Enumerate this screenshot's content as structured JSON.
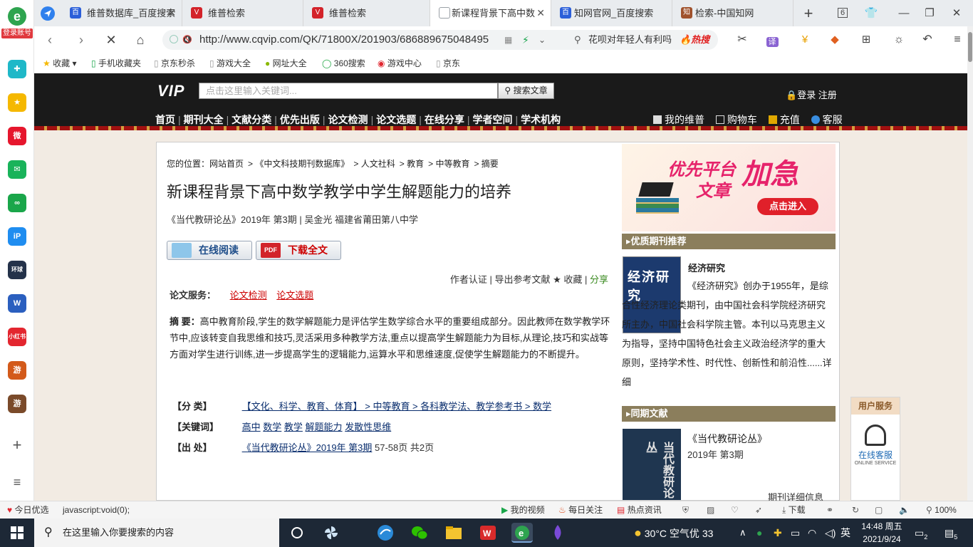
{
  "sidebar": {
    "account_label": "登录账号",
    "apps": [
      {
        "icon": "plus-app-icon",
        "color": "#1fb8c8",
        "text": "✚"
      },
      {
        "icon": "star-app-icon",
        "color": "#f5b800",
        "text": "★"
      },
      {
        "icon": "weibo-icon",
        "color": "#e6162d",
        "text": "微"
      },
      {
        "icon": "mail-app-icon",
        "color": "#19b35a",
        "text": "✉"
      },
      {
        "icon": "link-app-icon",
        "color": "#1aa64a",
        "text": "∞"
      },
      {
        "icon": "ip-app-icon",
        "color": "#1f8df0",
        "text": "iP"
      },
      {
        "icon": "globe-school-icon",
        "color": "#24324a",
        "text": "环球"
      },
      {
        "icon": "word-doc-icon",
        "color": "#2b5fbf",
        "text": "W"
      },
      {
        "icon": "xiaohongshu-icon",
        "color": "#e3262f",
        "text": "小红书"
      },
      {
        "icon": "game-app-icon",
        "color": "#d35a1a",
        "text": "游"
      },
      {
        "icon": "game2-app-icon",
        "color": "#7a4a2a",
        "text": "游"
      }
    ],
    "add_label": "+",
    "menu_label": "≡"
  },
  "tabs": [
    {
      "label": "维普数据库_百度搜索",
      "favicon": "baidu-paw-icon",
      "color": "#2b5fd9",
      "fav_text": "百"
    },
    {
      "label": "维普检索",
      "favicon": "vip-check-icon",
      "color": "#d3232a",
      "fav_text": "V"
    },
    {
      "label": "维普检索",
      "favicon": "vip-check-icon",
      "color": "#d3232a",
      "fav_text": "V"
    },
    {
      "label": "新课程背景下高中数",
      "favicon": "page-icon",
      "color": "#9aa0a6",
      "fav_text": "▯",
      "active": true
    },
    {
      "label": "知网官网_百度搜索",
      "favicon": "baidu-paw-icon",
      "color": "#2b5fd9",
      "fav_text": "百"
    },
    {
      "label": "检索-中国知网",
      "favicon": "cnki-icon",
      "color": "#a0522d",
      "fav_text": "知"
    }
  ],
  "tab_controls": {
    "new_tab": "+",
    "tab_count": "6"
  },
  "navbar": {
    "url": "http://www.cqvip.com/QK/71800X/201903/686889675048495",
    "search_text": "花呗对年轻人有利吗",
    "search_hot": "🔥热搜",
    "translate_label": "译"
  },
  "bookmarks": [
    "收藏",
    "手机收藏夹",
    "京东秒杀",
    "游戏大全",
    "网址大全",
    "360搜索",
    "游戏中心",
    "京东"
  ],
  "site": {
    "logo": "VIP",
    "search_placeholder": "点击这里输入关键词...",
    "search_button": "搜索文章",
    "login": "登录 注册",
    "nav": [
      "首页",
      "期刊大全",
      "文献分类",
      "优先出版",
      "论文检测",
      "论文选题",
      "在线分享",
      "学者空间",
      "学术机构"
    ],
    "right_nav": [
      "我的维普",
      "购物车",
      "充值",
      "客服"
    ]
  },
  "article": {
    "breadcrumb": [
      "您的位置：网站首页",
      "《中文科技期刊数据库》",
      "人文社科",
      "教育",
      "中等教育",
      "摘要"
    ],
    "title": "新课程背景下高中数学教学中学生解题能力的培养",
    "meta": "《当代教研论丛》2019年 第3期 | 吴金光   福建省莆田第八中学",
    "read_button": "在线阅读",
    "download_button": "下载全文",
    "tools": "作者认证 | 导出参考文献 ★ 收藏 |",
    "share": "分享",
    "service_label": "论文服务：",
    "service_links": [
      "论文检测",
      "论文选题"
    ],
    "abstract_label": "摘   要：",
    "abstract_text": "高中教育阶段,学生的数学解题能力是评估学生数学综合水平的重要组成部分。因此教师在数学教学环节中,应该转变自我思维和技巧,灵活采用多种教学方法,重点以提高学生解题能力为目标,从理论,技巧和实战等方面对学生进行训练,进一步提高学生的逻辑能力,运算水平和思维速度,促使学生解题能力的不断提升。",
    "class_label": "【分   类】",
    "class_value": "【文化、科学、教育、体育】 > 中等教育 > 各科教学法、教学参考书 > 数学",
    "keywords_label": "【关键词】",
    "keywords": [
      "高中",
      "数学",
      "教学",
      "解题能力",
      "发散性思维"
    ],
    "source_label": "【出   处】",
    "source_link": "《当代教研论丛》2019年 第3期",
    "source_pages": "57-58页 共2页"
  },
  "aside": {
    "ad_line1": "优先平台",
    "ad_line1b": "文章",
    "ad_line2": "加急",
    "ad_button": "点击进入",
    "recommend_head": "▸优质期刊推荐",
    "journal_cover_title": "经济研究",
    "journal_name": "经济研究",
    "journal_desc": "《经济研究》创办于1955年，是综合性经济理论类期刊，由中国社会科学院经济研究所主办，中国社会科学院主管。本刊以马克思主义为指导，坚持中国特色社会主义政治经济学的重大原则，坚持学术性、时代性、创新性和前沿性......详细",
    "same_head": "▸同期文献",
    "same_cover_title": "当代教研论丛",
    "same_title": "《当代教研论丛》",
    "same_issue": "2019年 第3期",
    "same_more": "期刊详细信息"
  },
  "service_float": {
    "head": "用户服务",
    "label": "在线客服",
    "sublabel": "ONLINE SERVICE"
  },
  "statusbar": {
    "left": "今日优选",
    "status": "javascript:void(0);",
    "items": [
      "我的视频",
      "每日关注",
      "热点资讯",
      "下载"
    ],
    "zoom": "100%"
  },
  "taskbar": {
    "search_placeholder": "在这里输入你要搜索的内容",
    "weather": "30°C  空气优 33",
    "ime": "英",
    "time": "14:48 周五",
    "date": "2021/9/24",
    "notify_count": "5",
    "msg_count": "2"
  }
}
